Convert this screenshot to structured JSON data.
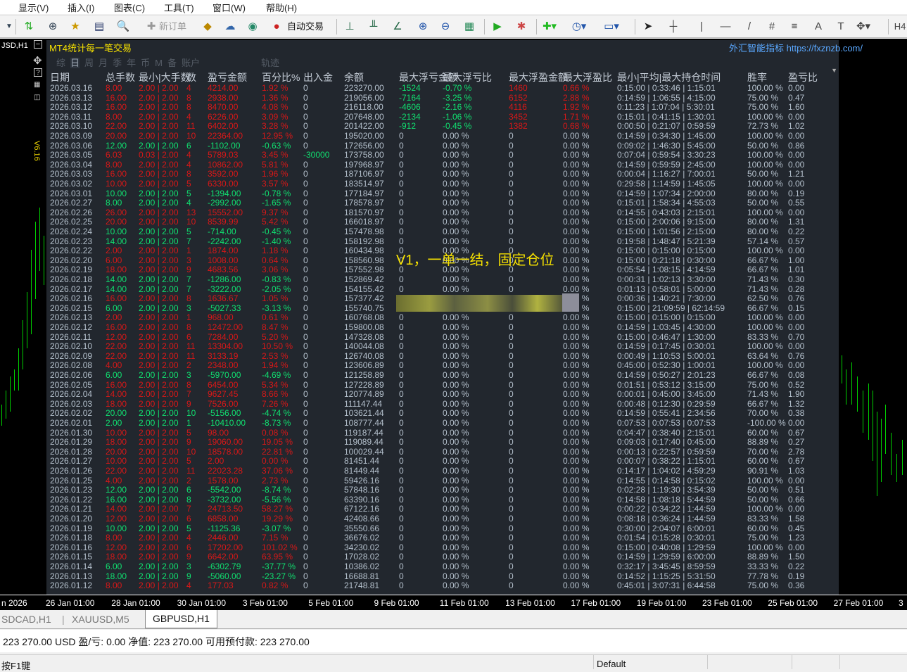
{
  "menu": [
    "显示(V)",
    "插入(I)",
    "图表(C)",
    "工具(T)",
    "窗口(W)",
    "帮助(H)"
  ],
  "toolbar": {
    "new_order": "新订单",
    "auto_trade": "自动交易",
    "period": "H4"
  },
  "chart": {
    "symbol": "JSD,H1",
    "version": "V6.16",
    "candle_color": "#00d000"
  },
  "panel": {
    "title": "MT4统计每一笔交易",
    "credit": "外汇智能指标 https://fxznzb.com/",
    "tabs": [
      "综",
      "日",
      "周",
      "月",
      "季",
      "年",
      "币",
      "M",
      "备",
      "账户",
      "轨迹"
    ],
    "headers": [
      "日期",
      "总手数",
      "最小|大手数",
      "数",
      "盈亏金额",
      "百分比%",
      "出入金",
      "余额",
      "最大浮亏金额",
      "最大浮亏比",
      "最大浮盈金额",
      "最大浮盈比",
      "最小|平均|最大持仓时间",
      "胜率",
      "盈亏比"
    ],
    "overlay": "V1，一单一结，固定仓位",
    "colors": {
      "profit": "#d81818",
      "loss": "#10e070",
      "neutral": "#b4c0cc"
    },
    "rows": [
      [
        "2026.03.16",
        "8.00",
        "2.00 | 2.00",
        "4",
        "4214.00",
        "1.92 %",
        "0",
        "223270.00",
        "-1524",
        "-0.70 %",
        "1460",
        "0.66 %",
        "0:15:00 | 0:33:46 | 1:15:01",
        "100.00 %",
        "0.00"
      ],
      [
        "2026.03.13",
        "16.00",
        "2.00 | 2.00",
        "8",
        "2938.00",
        "1.36 %",
        "0",
        "219056.00",
        "-7164",
        "-3.25 %",
        "6152",
        "2.88 %",
        "0:14:59 | 1:06:55 | 4:15:00",
        "75.00 %",
        "0.47"
      ],
      [
        "2026.03.12",
        "16.00",
        "2.00 | 2.00",
        "8",
        "8470.00",
        "4.08 %",
        "0",
        "216118.00",
        "-4606",
        "-2.16 %",
        "4116",
        "1.92 %",
        "0:11:23 | 1:07:04 | 5:30:01",
        "75.00 %",
        "1.60"
      ],
      [
        "2026.03.11",
        "8.00",
        "2.00 | 2.00",
        "4",
        "6226.00",
        "3.09 %",
        "0",
        "207648.00",
        "-2134",
        "-1.06 %",
        "3452",
        "1.71 %",
        "0:15:01 | 0:41:15 | 1:30:01",
        "100.00 %",
        "0.00"
      ],
      [
        "2026.03.10",
        "22.00",
        "2.00 | 2.00",
        "11",
        "6402.00",
        "3.28 %",
        "0",
        "201422.00",
        "-912",
        "-0.45 %",
        "1382",
        "0.68 %",
        "0:00:50 | 0:21:07 | 0:59:59",
        "72.73 %",
        "1.02"
      ],
      [
        "2026.03.09",
        "20.00",
        "2.00 | 2.00",
        "10",
        "22364.00",
        "12.95 %",
        "0",
        "195020.00",
        "0",
        "0.00 %",
        "0",
        "0.00 %",
        "0:14:59 | 0:34:30 | 1:45:00",
        "100.00 %",
        "0.00"
      ],
      [
        "2026.03.06",
        "12.00",
        "2.00 | 2.00",
        "6",
        "-1102.00",
        "-0.63 %",
        "0",
        "172656.00",
        "0",
        "0.00 %",
        "0",
        "0.00 %",
        "0:09:02 | 1:46:30 | 5:45:00",
        "50.00 %",
        "0.86"
      ],
      [
        "2026.03.05",
        "6.03",
        "0.03 | 2.00",
        "4",
        "5789.03",
        "3.45 %",
        "-30000",
        "173758.00",
        "0",
        "0.00 %",
        "0",
        "0.00 %",
        "0:07:04 | 0:59:54 | 3:30:23",
        "100.00 %",
        "0.00"
      ],
      [
        "2026.03.04",
        "8.00",
        "2.00 | 2.00",
        "4",
        "10862.00",
        "5.81 %",
        "0",
        "197968.97",
        "0",
        "0.00 %",
        "0",
        "0.00 %",
        "0:14:59 | 0:59:59 | 2:45:00",
        "100.00 %",
        "0.00"
      ],
      [
        "2026.03.03",
        "16.00",
        "2.00 | 2.00",
        "8",
        "3592.00",
        "1.96 %",
        "0",
        "187106.97",
        "0",
        "0.00 %",
        "0",
        "0.00 %",
        "0:00:04 | 1:16:27 | 7:00:01",
        "50.00 %",
        "1.21"
      ],
      [
        "2026.03.02",
        "10.00",
        "2.00 | 2.00",
        "5",
        "6330.00",
        "3.57 %",
        "0",
        "183514.97",
        "0",
        "0.00 %",
        "0",
        "0.00 %",
        "0:29:58 | 1:14:59 | 1:45:05",
        "100.00 %",
        "0.00"
      ],
      [
        "2026.03.01",
        "10.00",
        "2.00 | 2.00",
        "5",
        "-1394.00",
        "-0.78 %",
        "0",
        "177184.97",
        "0",
        "0.00 %",
        "0",
        "0.00 %",
        "0:14:59 | 1:07:34 | 2:00:00",
        "80.00 %",
        "0.19"
      ],
      [
        "2026.02.27",
        "8.00",
        "2.00 | 2.00",
        "4",
        "-2992.00",
        "-1.65 %",
        "0",
        "178578.97",
        "0",
        "0.00 %",
        "0",
        "0.00 %",
        "0:15:01 | 1:58:34 | 4:55:03",
        "50.00 %",
        "0.55"
      ],
      [
        "2026.02.26",
        "26.00",
        "2.00 | 2.00",
        "13",
        "15552.00",
        "9.37 %",
        "0",
        "181570.97",
        "0",
        "0.00 %",
        "0",
        "0.00 %",
        "0:14:55 | 0:43:03 | 2:15:01",
        "100.00 %",
        "0.00"
      ],
      [
        "2026.02.25",
        "20.00",
        "2.00 | 2.00",
        "10",
        "8539.99",
        "5.42 %",
        "0",
        "166018.97",
        "0",
        "0.00 %",
        "0",
        "0.00 %",
        "0:15:00 | 2:00:06 | 9:15:00",
        "80.00 %",
        "1.31"
      ],
      [
        "2026.02.24",
        "10.00",
        "2.00 | 2.00",
        "5",
        "-714.00",
        "-0.45 %",
        "0",
        "157478.98",
        "0",
        "0.00 %",
        "0",
        "0.00 %",
        "0:15:00 | 1:01:56 | 2:15:00",
        "80.00 %",
        "0.22"
      ],
      [
        "2026.02.23",
        "14.00",
        "2.00 | 2.00",
        "7",
        "-2242.00",
        "-1.40 %",
        "0",
        "158192.98",
        "0",
        "0.00 %",
        "0",
        "0.00 %",
        "0:19:58 | 1:48:47 | 5:21:39",
        "57.14 %",
        "0.57"
      ],
      [
        "2026.02.22",
        "2.00",
        "2.00 | 2.00",
        "1",
        "1874.00",
        "1.18 %",
        "0",
        "160434.98",
        "0",
        "0.00 %",
        "0",
        "0.00 %",
        "0:15:00 | 0:15:00 | 0:15:00",
        "100.00 %",
        "0.00"
      ],
      [
        "2026.02.20",
        "6.00",
        "2.00 | 2.00",
        "3",
        "1008.00",
        "0.64 %",
        "0",
        "158560.98",
        "0",
        "0.00 %",
        "0",
        "0.00 %",
        "0:15:00 | 0:21:18 | 0:30:00",
        "66.67 %",
        "1.00"
      ],
      [
        "2026.02.19",
        "18.00",
        "2.00 | 2.00",
        "9",
        "4683.56",
        "3.06 %",
        "0",
        "157552.98",
        "0",
        "0.00 %",
        "0",
        "0.00 %",
        "0:05:54 | 1:08:15 | 4:14:59",
        "66.67 %",
        "1.01"
      ],
      [
        "2026.02.18",
        "14.00",
        "2.00 | 2.00",
        "7",
        "-1286.00",
        "-0.83 %",
        "0",
        "152869.42",
        "0",
        "0.00 %",
        "0",
        "0.00 %",
        "0:00:31 | 1:02:13 | 3:30:00",
        "71.43 %",
        "0.30"
      ],
      [
        "2026.02.17",
        "14.00",
        "2.00 | 2.00",
        "7",
        "-3222.00",
        "-2.05 %",
        "0",
        "154155.42",
        "0",
        "0.00 %",
        "0",
        "0.00 %",
        "0:01:13 | 0:58:01 | 5:00:00",
        "71.43 %",
        "0.28"
      ],
      [
        "2026.02.16",
        "16.00",
        "2.00 | 2.00",
        "8",
        "1636.67",
        "1.05 %",
        "0",
        "157377.42",
        "0",
        "0.00 %",
        "0",
        "0.00 %",
        "0:00:36 | 1:40:21 | 7:30:00",
        "62.50 %",
        "0.76"
      ],
      [
        "2026.02.15",
        "6.00",
        "2.00 | 2.00",
        "3",
        "-5027.33",
        "-3.13 %",
        "0",
        "155740.75",
        "0",
        "0.00 %",
        "0",
        "0.00 %",
        "0:15:00 | 21:09:59 | 62:14:59",
        "66.67 %",
        "0.15"
      ],
      [
        "2026.02.13",
        "2.00",
        "2.00 | 2.00",
        "1",
        "968.00",
        "0.61 %",
        "0",
        "160768.08",
        "0",
        "0.00 %",
        "0",
        "0.00 %",
        "0:15:00 | 0:15:00 | 0:15:00",
        "100.00 %",
        "0.00"
      ],
      [
        "2026.02.12",
        "16.00",
        "2.00 | 2.00",
        "8",
        "12472.00",
        "8.47 %",
        "0",
        "159800.08",
        "0",
        "0.00 %",
        "0",
        "0.00 %",
        "0:14:59 | 1:03:45 | 4:30:00",
        "100.00 %",
        "0.00"
      ],
      [
        "2026.02.11",
        "12.00",
        "2.00 | 2.00",
        "6",
        "7284.00",
        "5.20 %",
        "0",
        "147328.08",
        "0",
        "0.00 %",
        "0",
        "0.00 %",
        "0:15:00 | 0:46:47 | 1:30:00",
        "83.33 %",
        "0.70"
      ],
      [
        "2026.02.10",
        "22.00",
        "2.00 | 2.00",
        "11",
        "13304.00",
        "10.50 %",
        "0",
        "140044.08",
        "0",
        "0.00 %",
        "0",
        "0.00 %",
        "0:14:59 | 0:17:45 | 0:30:01",
        "100.00 %",
        "0.00"
      ],
      [
        "2026.02.09",
        "22.00",
        "2.00 | 2.00",
        "11",
        "3133.19",
        "2.53 %",
        "0",
        "126740.08",
        "0",
        "0.00 %",
        "0",
        "0.00 %",
        "0:00:49 | 1:10:53 | 5:00:01",
        "63.64 %",
        "0.76"
      ],
      [
        "2026.02.08",
        "4.00",
        "2.00 | 2.00",
        "2",
        "2348.00",
        "1.94 %",
        "0",
        "123606.89",
        "0",
        "0.00 %",
        "0",
        "0.00 %",
        "0:45:00 | 0:52:30 | 1:00:01",
        "100.00 %",
        "0.00"
      ],
      [
        "2026.02.06",
        "6.00",
        "2.00 | 2.00",
        "3",
        "-5970.00",
        "-4.69 %",
        "0",
        "121258.89",
        "0",
        "0.00 %",
        "0",
        "0.00 %",
        "0:14:59 | 0:50:27 | 2:01:23",
        "66.67 %",
        "0.08"
      ],
      [
        "2026.02.05",
        "16.00",
        "2.00 | 2.00",
        "8",
        "6454.00",
        "5.34 %",
        "0",
        "127228.89",
        "0",
        "0.00 %",
        "0",
        "0.00 %",
        "0:01:51 | 0:53:12 | 3:15:00",
        "75.00 %",
        "0.52"
      ],
      [
        "2026.02.04",
        "14.00",
        "2.00 | 2.00",
        "7",
        "9627.45",
        "8.66 %",
        "0",
        "120774.89",
        "0",
        "0.00 %",
        "0",
        "0.00 %",
        "0:00:01 | 0:45:00 | 3:45:00",
        "71.43 %",
        "1.90"
      ],
      [
        "2026.02.03",
        "18.00",
        "2.00 | 2.00",
        "9",
        "7526.00",
        "7.26 %",
        "0",
        "111147.44",
        "0",
        "0.00 %",
        "0",
        "0.00 %",
        "0:00:48 | 0:12:30 | 0:29:59",
        "66.67 %",
        "1.32"
      ],
      [
        "2026.02.02",
        "20.00",
        "2.00 | 2.00",
        "10",
        "-5156.00",
        "-4.74 %",
        "0",
        "103621.44",
        "0",
        "0.00 %",
        "0",
        "0.00 %",
        "0:14:59 | 0:55:41 | 2:34:56",
        "70.00 %",
        "0.38"
      ],
      [
        "2026.02.01",
        "2.00",
        "2.00 | 2.00",
        "1",
        "-10410.00",
        "-8.73 %",
        "0",
        "108777.44",
        "0",
        "0.00 %",
        "0",
        "0.00 %",
        "0:07:53 | 0:07:53 | 0:07:53",
        "-100.00 %",
        "0.00"
      ],
      [
        "2026.01.30",
        "10.00",
        "2.00 | 2.00",
        "5",
        "98.00",
        "0.08 %",
        "0",
        "119187.44",
        "0",
        "0.00 %",
        "0",
        "0.00 %",
        "0:04:47 | 0:38:40 | 2:15:01",
        "60.00 %",
        "0.67"
      ],
      [
        "2026.01.29",
        "18.00",
        "2.00 | 2.00",
        "9",
        "19060.00",
        "19.05 %",
        "0",
        "119089.44",
        "0",
        "0.00 %",
        "0",
        "0.00 %",
        "0:09:03 | 0:17:40 | 0:45:00",
        "88.89 %",
        "0.27"
      ],
      [
        "2026.01.28",
        "20.00",
        "2.00 | 2.00",
        "10",
        "18578.00",
        "22.81 %",
        "0",
        "100029.44",
        "0",
        "0.00 %",
        "0",
        "0.00 %",
        "0:00:13 | 0:22:57 | 0:59:59",
        "70.00 %",
        "2.78"
      ],
      [
        "2026.01.27",
        "10.00",
        "2.00 | 2.00",
        "5",
        "2.00",
        "0.00 %",
        "0",
        "81451.44",
        "0",
        "0.00 %",
        "0",
        "0.00 %",
        "0:00:07 | 0:38:22 | 1:15:01",
        "60.00 %",
        "0.67"
      ],
      [
        "2026.01.26",
        "22.00",
        "2.00 | 2.00",
        "11",
        "22023.28",
        "37.06 %",
        "0",
        "81449.44",
        "0",
        "0.00 %",
        "0",
        "0.00 %",
        "0:14:17 | 1:04:02 | 4:59:29",
        "90.91 %",
        "1.03"
      ],
      [
        "2026.01.25",
        "4.00",
        "2.00 | 2.00",
        "2",
        "1578.00",
        "2.73 %",
        "0",
        "59426.16",
        "0",
        "0.00 %",
        "0",
        "0.00 %",
        "0:14:55 | 0:14:58 | 0:15:02",
        "100.00 %",
        "0.00"
      ],
      [
        "2026.01.23",
        "12.00",
        "2.00 | 2.00",
        "6",
        "-5542.00",
        "-8.74 %",
        "0",
        "57848.16",
        "0",
        "0.00 %",
        "0",
        "0.00 %",
        "0:02:28 | 1:19:30 | 3:54:39",
        "50.00 %",
        "0.51"
      ],
      [
        "2026.01.22",
        "16.00",
        "2.00 | 2.00",
        "8",
        "-3732.00",
        "-5.56 %",
        "0",
        "63390.16",
        "0",
        "0.00 %",
        "0",
        "0.00 %",
        "0:14:58 | 1:08:18 | 5:44:59",
        "50.00 %",
        "0.66"
      ],
      [
        "2026.01.21",
        "14.00",
        "2.00 | 2.00",
        "7",
        "24713.50",
        "58.27 %",
        "0",
        "67122.16",
        "0",
        "0.00 %",
        "0",
        "0.00 %",
        "0:00:22 | 0:34:22 | 1:44:59",
        "100.00 %",
        "0.00"
      ],
      [
        "2026.01.20",
        "12.00",
        "2.00 | 2.00",
        "6",
        "6858.00",
        "19.29 %",
        "0",
        "42408.66",
        "0",
        "0.00 %",
        "0",
        "0.00 %",
        "0:08:18 | 0:36:24 | 1:44:59",
        "83.33 %",
        "1.58"
      ],
      [
        "2026.01.19",
        "10.00",
        "2.00 | 2.00",
        "5",
        "-1125.36",
        "-3.07 %",
        "0",
        "35550.66",
        "0",
        "0.00 %",
        "0",
        "0.00 %",
        "0:30:00 | 2:04:07 | 6:00:01",
        "60.00 %",
        "0.45"
      ],
      [
        "2026.01.18",
        "8.00",
        "2.00 | 2.00",
        "4",
        "2446.00",
        "7.15 %",
        "0",
        "36676.02",
        "0",
        "0.00 %",
        "0",
        "0.00 %",
        "0:01:54 | 0:15:28 | 0:30:01",
        "75.00 %",
        "1.23"
      ],
      [
        "2026.01.16",
        "12.00",
        "2.00 | 2.00",
        "6",
        "17202.00",
        "101.02 %",
        "0",
        "34230.02",
        "0",
        "0.00 %",
        "0",
        "0.00 %",
        "0:15:00 | 0:40:08 | 1:29:59",
        "100.00 %",
        "0.00"
      ],
      [
        "2026.01.15",
        "18.00",
        "2.00 | 2.00",
        "9",
        "6642.00",
        "63.95 %",
        "0",
        "17028.02",
        "0",
        "0.00 %",
        "0",
        "0.00 %",
        "0:14:59 | 1:29:59 | 6:00:00",
        "88.89 %",
        "1.50"
      ],
      [
        "2026.01.14",
        "6.00",
        "2.00 | 2.00",
        "3",
        "-6302.79",
        "-37.77 %",
        "0",
        "10386.02",
        "0",
        "0.00 %",
        "0",
        "0.00 %",
        "0:32:17 | 3:45:45 | 8:59:59",
        "33.33 %",
        "0.22"
      ],
      [
        "2026.01.13",
        "18.00",
        "2.00 | 2.00",
        "9",
        "-5060.00",
        "-23.27 %",
        "0",
        "16688.81",
        "0",
        "0.00 %",
        "0",
        "0.00 %",
        "0:14:52 | 1:15:25 | 5:31:50",
        "77.78 %",
        "0.19"
      ],
      [
        "2026.01.12",
        "8.00",
        "2.00 | 2.00",
        "4",
        "177.03",
        "0.82 %",
        "0",
        "21748.81",
        "0",
        "0.00 %",
        "0",
        "0.00 %",
        "0:45:01 | 3:07:31 | 6:44:58",
        "75.00 %",
        "0.36"
      ]
    ]
  },
  "axis": [
    "n 2026",
    "26 Jan 01:00",
    "28 Jan 01:00",
    "30 Jan 01:00",
    "3 Feb 01:00",
    "5 Feb 01:00",
    "9 Feb 01:00",
    "11 Feb 01:00",
    "13 Feb 01:00",
    "17 Feb 01:00",
    "19 Feb 01:00",
    "23 Feb 01:00",
    "25 Feb 01:00",
    "27 Feb 01:00",
    "3"
  ],
  "chart_tabs": [
    "SDCAD,H1",
    "XAUUSD,M5",
    "GBPUSD,H1"
  ],
  "account": "223 270.00 USD  盈/亏: 0.00  净值: 223 270.00  可用预付款: 223 270.00",
  "status": {
    "help": "按F1键",
    "profile": "Default"
  }
}
